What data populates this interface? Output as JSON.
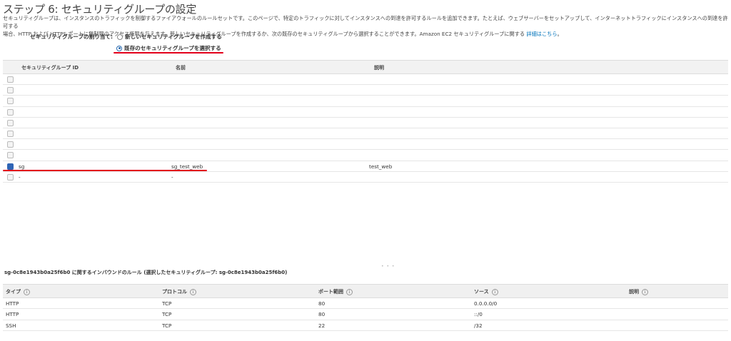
{
  "page": {
    "title": "ステップ 6: セキュリティグループの設定",
    "description_line1": "セキュリティグループは、インスタンスのトラフィックを制御するファイアウォールのルールセットです。このページで、特定のトラフィックに対してインスタンスへの到達を許可するルールを追加できます。たとえば、ウェブサーバーをセットアップして、インターネットトラフィックにインスタンスへの到達を許可する",
    "description_line2": "場合、HTTP および HTTPS ポートに無制限のアクセス権限を与えます。新しいセキュリティグループを作成するか、次の既存のセキュリティグループから選択することができます。Amazon EC2 セキュリティグループに関する",
    "description_link": "詳細はこちら",
    "description_end": "。"
  },
  "assign": {
    "label": "セキュリティグループの割り当て:",
    "option_new": "新しいセキュリティグループを作成する",
    "option_existing": "既存のセキュリティグループを選択する",
    "selected": "existing"
  },
  "sg_table": {
    "headers": [
      "セキュリティグループ ID",
      "名前",
      "説明"
    ],
    "rows": [
      {
        "id": "",
        "name": "",
        "desc": "",
        "checked": false
      },
      {
        "id": "",
        "name": "",
        "desc": "",
        "checked": false
      },
      {
        "id": "",
        "name": "",
        "desc": "",
        "checked": false
      },
      {
        "id": "",
        "name": "",
        "desc": "",
        "checked": false
      },
      {
        "id": "",
        "name": "",
        "desc": "",
        "checked": false
      },
      {
        "id": "",
        "name": "",
        "desc": "",
        "checked": false
      },
      {
        "id": "",
        "name": "",
        "desc": "",
        "checked": false
      },
      {
        "id": "",
        "name": "",
        "desc": "",
        "checked": false
      },
      {
        "id": "sg",
        "name": "sg_test_web",
        "desc": "test_web",
        "checked": true
      },
      {
        "id": "-",
        "name": "-",
        "desc": "",
        "checked": false
      }
    ]
  },
  "splitter": "• • •",
  "rules_title": "sg-0c8e1943b0a25f6b0 に関するインバウンドのルール (選択したセキュリティグループ: sg-0c8e1943b0a25f6b0)",
  "rules_table": {
    "headers": [
      "タイプ",
      "プロトコル",
      "ポート範囲",
      "ソース",
      "説明"
    ],
    "info_icon": "i",
    "rows": [
      {
        "type": "HTTP",
        "protocol": "TCP",
        "port": "80",
        "source": "0.0.0.0/0",
        "desc": ""
      },
      {
        "type": "HTTP",
        "protocol": "TCP",
        "port": "80",
        "source": "::/0",
        "desc": ""
      },
      {
        "type": "SSH",
        "protocol": "TCP",
        "port": "22",
        "source": "/32",
        "desc": ""
      }
    ]
  },
  "colors": {
    "accent": "#2f64b5",
    "annotation_red": "#e3001b",
    "link": "#0073bb"
  }
}
